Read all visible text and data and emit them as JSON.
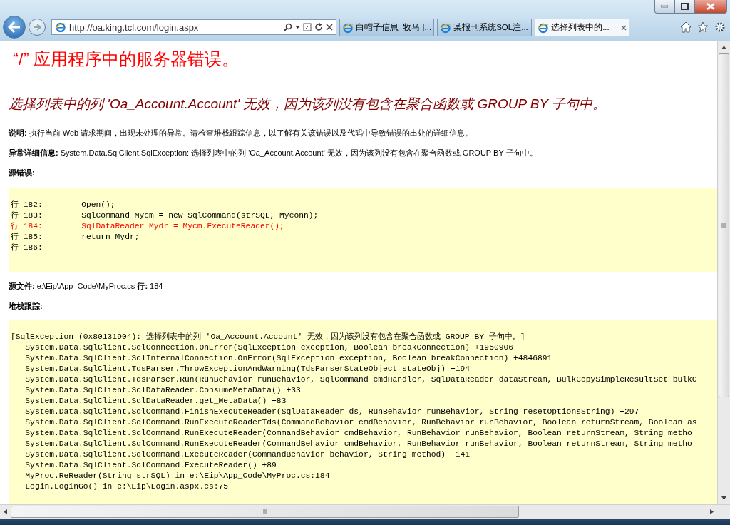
{
  "browser": {
    "url": "http://oa.king.tcl.com/login.aspx",
    "tabs": [
      {
        "title": "白帽子信息_牧马 |...",
        "selected": false
      },
      {
        "title": "某报刊系统SQL注...",
        "selected": false
      },
      {
        "title": "选择列表中的...",
        "selected": true
      }
    ]
  },
  "page": {
    "title": "“/” 应用程序中的服务器错误。",
    "message": "选择列表中的列 'Oa_Account.Account' 无效，因为该列没有包含在聚合函数或 GROUP BY 子句中。",
    "description": {
      "label": "说明:",
      "text": "执行当前 Web 请求期间，出现未处理的异常。请检查堆栈跟踪信息，以了解有关该错误以及代码中导致错误的出处的详细信息。"
    },
    "exception_details": {
      "label": "异常详细信息:",
      "text": "System.Data.SqlClient.SqlException: 选择列表中的列 'Oa_Account.Account' 无效，因为该列没有包含在聚合函数或 GROUP BY 子句中。"
    },
    "source_error": {
      "label": "源错误:"
    },
    "source_lines": [
      {
        "text": "行 182:        Open();",
        "highlighted": false
      },
      {
        "text": "行 183:        SqlCommand Mycm = new SqlCommand(strSQL, Myconn);",
        "highlighted": false
      },
      {
        "text": "行 184:        SqlDataReader Mydr = Mycm.ExecuteReader();",
        "highlighted": true
      },
      {
        "text": "行 185:        return Mydr;",
        "highlighted": false
      },
      {
        "text": "行 186:",
        "highlighted": false
      }
    ],
    "source_file": {
      "label": "源文件:",
      "path": "e:\\Eip\\App_Code\\MyProc.cs",
      "line_label": "行:",
      "line": "184"
    },
    "stack_trace": {
      "label": "堆栈跟踪:",
      "lines": [
        "[SqlException (0x80131904): 选择列表中的列 'Oa_Account.Account' 无效，因为该列没有包含在聚合函数或 GROUP BY 子句中。]",
        "   System.Data.SqlClient.SqlConnection.OnError(SqlException exception, Boolean breakConnection) +1950906",
        "   System.Data.SqlClient.SqlInternalConnection.OnError(SqlException exception, Boolean breakConnection) +4846891",
        "   System.Data.SqlClient.TdsParser.ThrowExceptionAndWarning(TdsParserStateObject stateObj) +194",
        "   System.Data.SqlClient.TdsParser.Run(RunBehavior runBehavior, SqlCommand cmdHandler, SqlDataReader dataStream, BulkCopySimpleResultSet bulkC",
        "   System.Data.SqlClient.SqlDataReader.ConsumeMetaData() +33",
        "   System.Data.SqlClient.SqlDataReader.get_MetaData() +83",
        "   System.Data.SqlClient.SqlCommand.FinishExecuteReader(SqlDataReader ds, RunBehavior runBehavior, String resetOptionsString) +297",
        "   System.Data.SqlClient.SqlCommand.RunExecuteReaderTds(CommandBehavior cmdBehavior, RunBehavior runBehavior, Boolean returnStream, Boolean as",
        "   System.Data.SqlClient.SqlCommand.RunExecuteReader(CommandBehavior cmdBehavior, RunBehavior runBehavior, Boolean returnStream, String metho",
        "   System.Data.SqlClient.SqlCommand.RunExecuteReader(CommandBehavior cmdBehavior, RunBehavior runBehavior, Boolean returnStream, String metho",
        "   System.Data.SqlClient.SqlCommand.ExecuteReader(CommandBehavior behavior, String method) +141",
        "   System.Data.SqlClient.SqlCommand.ExecuteReader() +89",
        "   MyProc.ReReader(String strSQL) in e:\\Eip\\App_Code\\MyProc.cs:184",
        "   Login.LoginGo() in e:\\Eip\\Login.aspx.cs:75"
      ]
    }
  }
}
